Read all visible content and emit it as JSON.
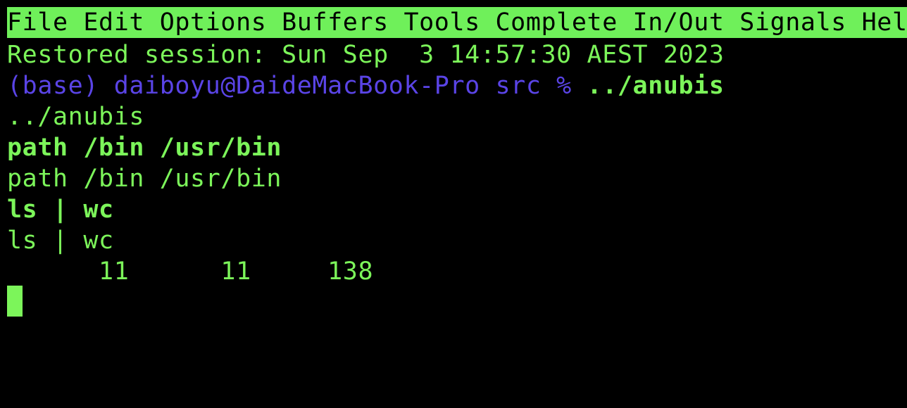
{
  "menubar": {
    "items": [
      "File",
      "Edit",
      "Options",
      "Buffers",
      "Tools",
      "Complete",
      "In/Out",
      "Signals",
      "Help"
    ]
  },
  "session": {
    "restored": "Restored session: Sun Sep  3 14:57:30 AEST 2023"
  },
  "prompt": {
    "text": "(base) daiboyu@DaideMacBook-Pro src % ",
    "command": "../anubis"
  },
  "output": {
    "lines": [
      {
        "text": "../anubis",
        "bold": false
      },
      {
        "text": "path /bin /usr/bin",
        "bold": true
      },
      {
        "text": "path /bin /usr/bin",
        "bold": false
      },
      {
        "text": "ls | wc",
        "bold": true
      },
      {
        "text": "ls | wc",
        "bold": false
      },
      {
        "text": "      11      11     138",
        "bold": false
      }
    ]
  },
  "colors": {
    "background": "#000000",
    "text": "#7cf55a",
    "menubar_bg": "#6ff05a",
    "prompt": "#5a44e6"
  }
}
